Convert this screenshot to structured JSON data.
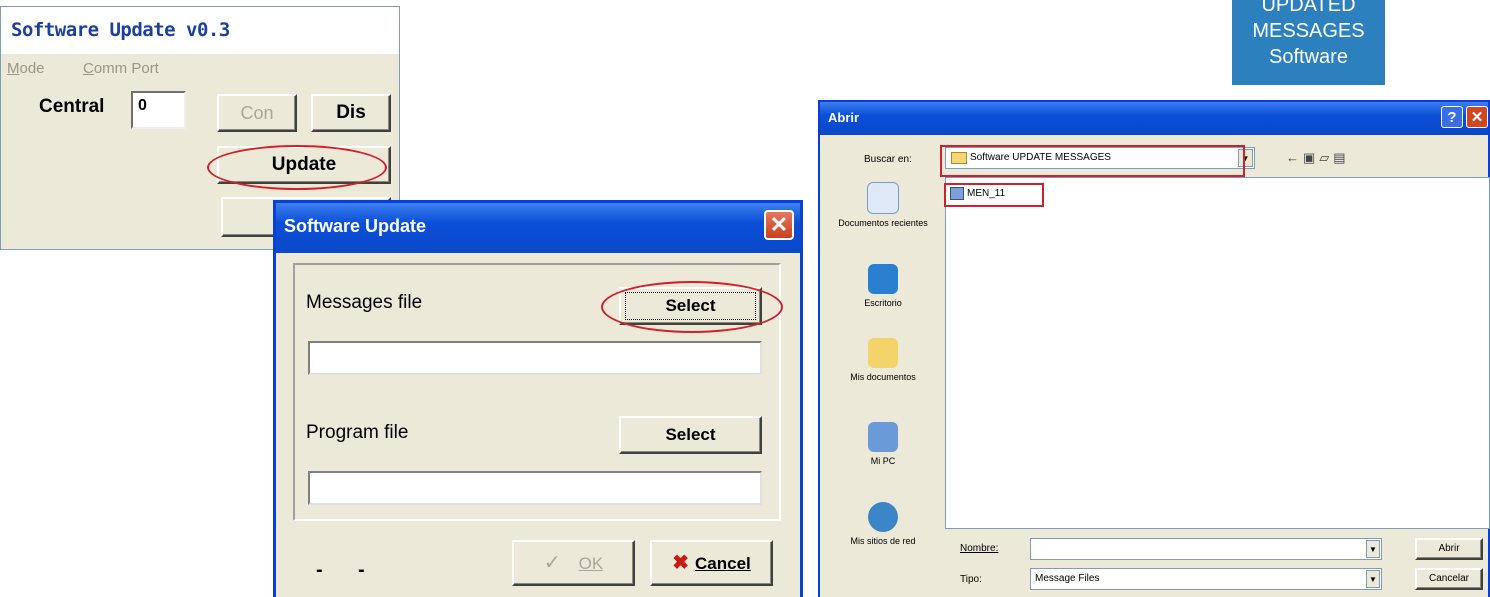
{
  "win1": {
    "title": "Software Update v0.3",
    "menu": [
      {
        "accel": "M",
        "rest": "ode"
      },
      {
        "accel": "C",
        "rest": "omm Port"
      }
    ],
    "central_label": "Central",
    "central_value": "0",
    "con_label": "Con",
    "dis_label": "Dis",
    "update_label": "Update"
  },
  "win2": {
    "title": "Software Update",
    "close_glyph": "✕",
    "messages_label": "Messages file",
    "program_label": "Program file",
    "select_label": "Select",
    "status_dash_1": "-",
    "status_dash_2": "-",
    "ok_label": "OK",
    "ok_icon": "✓",
    "cancel_label": "Cancel",
    "cancel_icon": "✖"
  },
  "win3": {
    "title": "Abrir",
    "buscar_label": "Buscar en:",
    "look_in_value": "Software UPDATE MESSAGES",
    "places": [
      "Documentos recientes",
      "Escritorio",
      "Mis documentos",
      "Mi PC",
      "Mis sitios de red"
    ],
    "file_item": "MEN_11",
    "nombre_label": "Nombre:",
    "nombre_value": "",
    "tipo_label": "Tipo:",
    "tipo_value": "Message Files",
    "open_label": "Abrir",
    "cancel_label": "Cancelar",
    "help_glyph": "?",
    "close_glyph": "✕"
  },
  "logo": {
    "line1": "UPDATED",
    "line2": "MESSAGES",
    "line3": "Software"
  },
  "colors": {
    "xp_blue": "#0b4fd8",
    "highlight_red": "#d0202a",
    "dialog_bg": "#ece9d8",
    "logo_blue": "#2b80bd"
  }
}
